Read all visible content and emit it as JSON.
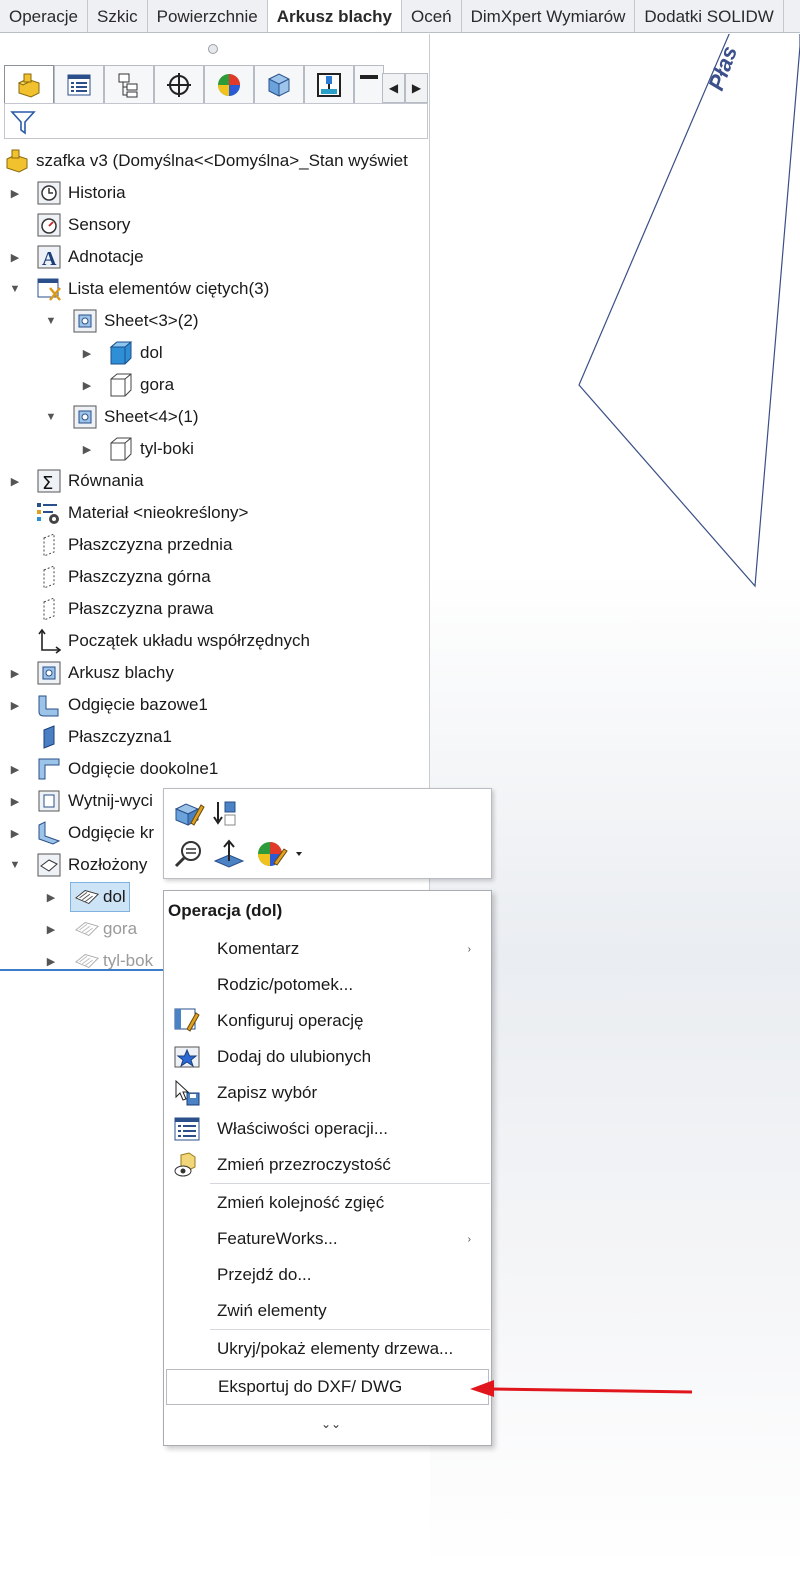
{
  "tabs": [
    "Operacje",
    "Szkic",
    "Powierzchnie",
    "Arkusz blachy",
    "Oceń",
    "DimXpert Wymiarów",
    "Dodatki SOLIDW"
  ],
  "active_tab": "Arkusz blachy",
  "viewport": {
    "plane_label": "Płas"
  },
  "tree": {
    "root": "szafka v3  (Domyślna<<Domyślna>_Stan wyświet",
    "items": [
      {
        "label": "Historia",
        "icon": "history-icon"
      },
      {
        "label": "Sensory",
        "icon": "sensor-icon"
      },
      {
        "label": "Adnotacje",
        "icon": "annotation-icon"
      },
      {
        "label": "Lista elementów ciętych(3)",
        "icon": "cut-list-icon"
      },
      {
        "label": "Sheet<3>(2)",
        "icon": "sheet-folder-icon"
      },
      {
        "label": "dol",
        "icon": "solid-body-icon"
      },
      {
        "label": "gora",
        "icon": "sheet-body-icon"
      },
      {
        "label": "Sheet<4>(1)",
        "icon": "sheet-folder-icon"
      },
      {
        "label": "tyl-boki",
        "icon": "sheet-body-icon"
      },
      {
        "label": "Równania",
        "icon": "equations-icon"
      },
      {
        "label": "Materiał <nieokreślony>",
        "icon": "material-icon"
      },
      {
        "label": "Płaszczyzna przednia",
        "icon": "plane-icon"
      },
      {
        "label": "Płaszczyzna górna",
        "icon": "plane-icon"
      },
      {
        "label": "Płaszczyzna prawa",
        "icon": "plane-icon"
      },
      {
        "label": "Początek układu współrzędnych",
        "icon": "origin-icon"
      },
      {
        "label": "Arkusz blachy",
        "icon": "sheet-metal-icon"
      },
      {
        "label": "Odgięcie bazowe1",
        "icon": "base-flange-icon"
      },
      {
        "label": "Płaszczyzna1",
        "icon": "plane-icon"
      },
      {
        "label": "Odgięcie dookolne1",
        "icon": "edge-flange-icon"
      },
      {
        "label": "Wytnij-wyci",
        "icon": "cut-extrude-icon"
      },
      {
        "label": "Odgięcie kr",
        "icon": "miter-flange-icon"
      },
      {
        "label": "Rozłożony",
        "icon": "flat-pattern-icon"
      },
      {
        "label": "dol",
        "icon": "flat-body-icon"
      },
      {
        "label": "gora",
        "icon": "flat-body-icon"
      },
      {
        "label": "tyl-bok",
        "icon": "flat-body-icon"
      }
    ]
  },
  "context_menu": {
    "title": "Operacja (dol)",
    "items": [
      {
        "label": "Komentarz",
        "submenu": "›"
      },
      {
        "label": "Rodzic/potomek..."
      },
      {
        "label": "Konfiguruj operację",
        "icon": "configure-feature-icon"
      },
      {
        "label": "Dodaj do ulubionych",
        "icon": "favorites-star-icon"
      },
      {
        "label": "Zapisz wybór",
        "icon": "save-selection-icon"
      },
      {
        "label": "Właściwości operacji...",
        "icon": "properties-list-icon"
      },
      {
        "label": "Zmień przezroczystość",
        "icon": "transparency-icon"
      },
      {
        "label": "Zmień kolejność zgięć"
      },
      {
        "label": "FeatureWorks...",
        "submenu": "›"
      },
      {
        "label": "Przejdź do..."
      },
      {
        "label": "Zwiń elementy"
      },
      {
        "label": "Ukryj/pokaż elementy drzewa..."
      },
      {
        "label": "Eksportuj do DXF/ DWG"
      }
    ],
    "more": "⌄⌄"
  },
  "colors": {
    "accent_blue": "#3d7cc9",
    "selection": "#cde4f7",
    "annotation_red": "#e0161c"
  }
}
